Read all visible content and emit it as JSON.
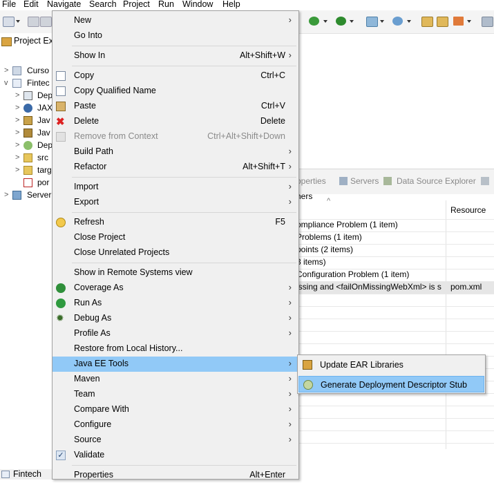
{
  "menubar": [
    "File",
    "Edit",
    "Navigate",
    "Search",
    "Project",
    "Run",
    "Window",
    "Help"
  ],
  "project_explorer": {
    "tab_label": "Project Ex",
    "tree": [
      {
        "label": "Curso",
        "twisty": ">",
        "icon": "project-icon"
      },
      {
        "label": "Fintec",
        "twisty": "v",
        "icon": "maven-project-icon"
      },
      {
        "label": "Dep",
        "twisty": ">",
        "icon": "deployment-descriptor-icon"
      },
      {
        "label": "JAX",
        "twisty": ">",
        "icon": "jax-ws-icon"
      },
      {
        "label": "Jav",
        "twisty": ">",
        "icon": "java-resources-icon"
      },
      {
        "label": "Jav",
        "twisty": ">",
        "icon": "libraries-icon"
      },
      {
        "label": "Dep",
        "twisty": ">",
        "icon": "deployed-resources-icon"
      },
      {
        "label": "src",
        "twisty": ">",
        "icon": "folder-icon"
      },
      {
        "label": "targ",
        "twisty": ">",
        "icon": "folder-icon"
      },
      {
        "label": "por",
        "twisty": "",
        "icon": "pom-file-icon"
      },
      {
        "label": "Server",
        "twisty": ">",
        "icon": "servers-folder-icon"
      }
    ]
  },
  "views_bar": {
    "properties": "operties",
    "servers": "Servers",
    "data_source": "Data Source Explorer"
  },
  "markers": {
    "column_header_left": "hers",
    "column_resource": "Resource",
    "rows": [
      {
        "desc": "ompliance Problem (1 item)",
        "resource": ""
      },
      {
        "desc": "Problems (1 item)",
        "resource": ""
      },
      {
        "desc": "points (2 items)",
        "resource": ""
      },
      {
        "desc": "3 items)",
        "resource": ""
      },
      {
        "desc": "Configuration Problem (1 item)",
        "resource": ""
      },
      {
        "desc": "issing and <failOnMissingWebXml> is s",
        "resource": "pom.xml"
      }
    ]
  },
  "context_menu": {
    "items": [
      {
        "label": "New",
        "shortcut": "",
        "submenu": true,
        "icon": ""
      },
      {
        "label": "Go Into",
        "shortcut": "",
        "submenu": false,
        "icon": ""
      },
      {
        "label": "Show In",
        "shortcut": "Alt+Shift+W",
        "submenu": true,
        "icon": ""
      },
      {
        "label": "Copy",
        "shortcut": "Ctrl+C",
        "submenu": false,
        "icon": "copy-icon"
      },
      {
        "label": "Copy Qualified Name",
        "shortcut": "",
        "submenu": false,
        "icon": "copy-qualified-icon"
      },
      {
        "label": "Paste",
        "shortcut": "Ctrl+V",
        "submenu": false,
        "icon": "paste-icon"
      },
      {
        "label": "Delete",
        "shortcut": "Delete",
        "submenu": false,
        "icon": "delete-icon"
      },
      {
        "label": "Remove from Context",
        "shortcut": "Ctrl+Alt+Shift+Down",
        "submenu": false,
        "icon": "remove-context-icon",
        "disabled": true
      },
      {
        "label": "Build Path",
        "shortcut": "",
        "submenu": true,
        "icon": ""
      },
      {
        "label": "Refactor",
        "shortcut": "Alt+Shift+T",
        "submenu": true,
        "icon": ""
      },
      {
        "label": "Import",
        "shortcut": "",
        "submenu": true,
        "icon": ""
      },
      {
        "label": "Export",
        "shortcut": "",
        "submenu": true,
        "icon": ""
      },
      {
        "label": "Refresh",
        "shortcut": "F5",
        "submenu": false,
        "icon": "refresh-icon"
      },
      {
        "label": "Close Project",
        "shortcut": "",
        "submenu": false,
        "icon": ""
      },
      {
        "label": "Close Unrelated Projects",
        "shortcut": "",
        "submenu": false,
        "icon": ""
      },
      {
        "label": "Show in Remote Systems view",
        "shortcut": "",
        "submenu": false,
        "icon": ""
      },
      {
        "label": "Coverage As",
        "shortcut": "",
        "submenu": true,
        "icon": "coverage-icon"
      },
      {
        "label": "Run As",
        "shortcut": "",
        "submenu": true,
        "icon": "run-icon"
      },
      {
        "label": "Debug As",
        "shortcut": "",
        "submenu": true,
        "icon": "debug-icon"
      },
      {
        "label": "Profile As",
        "shortcut": "",
        "submenu": true,
        "icon": ""
      },
      {
        "label": "Restore from Local History...",
        "shortcut": "",
        "submenu": false,
        "icon": ""
      },
      {
        "label": "Java EE Tools",
        "shortcut": "",
        "submenu": true,
        "icon": "",
        "highlighted": true
      },
      {
        "label": "Maven",
        "shortcut": "",
        "submenu": true,
        "icon": ""
      },
      {
        "label": "Team",
        "shortcut": "",
        "submenu": true,
        "icon": ""
      },
      {
        "label": "Compare With",
        "shortcut": "",
        "submenu": true,
        "icon": ""
      },
      {
        "label": "Configure",
        "shortcut": "",
        "submenu": true,
        "icon": ""
      },
      {
        "label": "Source",
        "shortcut": "",
        "submenu": true,
        "icon": ""
      },
      {
        "label": "Validate",
        "shortcut": "",
        "submenu": false,
        "icon": "checkmark-icon"
      },
      {
        "label": "Properties",
        "shortcut": "Alt+Enter",
        "submenu": false,
        "icon": ""
      }
    ]
  },
  "submenu": {
    "items": [
      {
        "label": "Update EAR Libraries",
        "icon": "update-ear-icon"
      },
      {
        "label": "Generate Deployment Descriptor Stub",
        "icon": "generate-descriptor-icon",
        "highlighted": true
      }
    ]
  },
  "bottom_tab": {
    "label": "Fintech"
  },
  "colors": {
    "highlight": "#91c9f7",
    "menu_bg": "#f0f0f0",
    "selected_row": "#e6e6e6"
  }
}
